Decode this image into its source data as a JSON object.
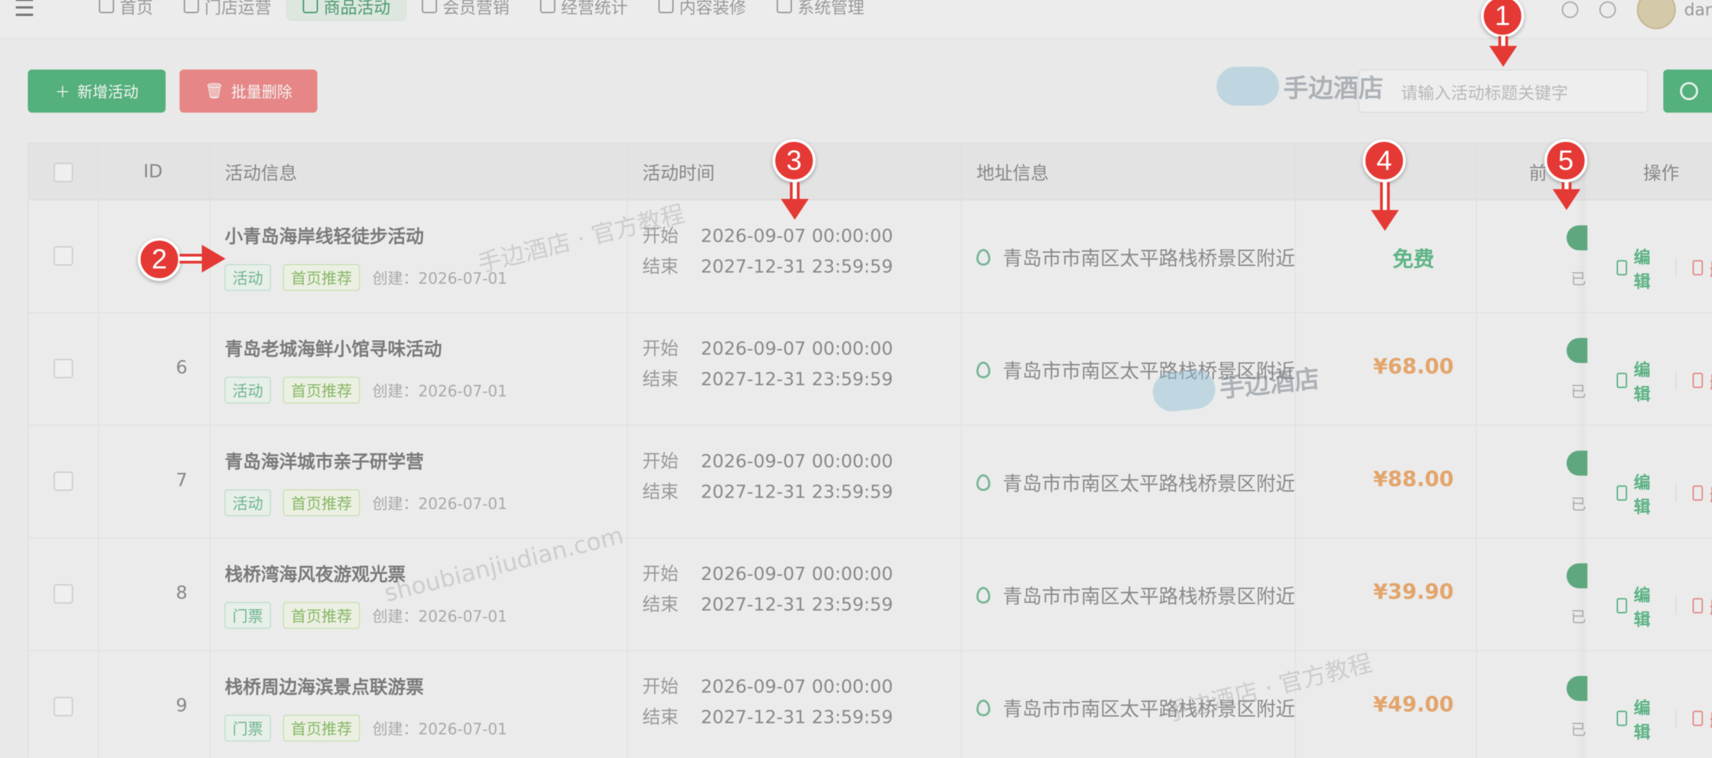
{
  "nav": {
    "items": [
      {
        "label": "首页"
      },
      {
        "label": "门店运营"
      },
      {
        "label": "商品活动"
      },
      {
        "label": "会员营销"
      },
      {
        "label": "经营统计"
      },
      {
        "label": "内容装修"
      },
      {
        "label": "系统管理"
      }
    ],
    "user_name": "dand"
  },
  "toolbar": {
    "add_label": "新增活动",
    "delete_label": "批量删除",
    "search_placeholder": "请输入活动标题关键字"
  },
  "brand": "手边酒店",
  "table": {
    "columns": {
      "id": "ID",
      "info": "活动信息",
      "time": "活动时间",
      "address": "地址信息",
      "front": "前",
      "actions": "操作"
    },
    "start_label": "开始",
    "end_label": "结束",
    "created_prefix": "创建：",
    "edit_label": "编辑",
    "delete_label": "删",
    "status_label": "已",
    "rows": [
      {
        "id": "",
        "title": "小青岛海岸线轻徒步活动",
        "tag": "活动",
        "tag2": "首页推荐",
        "created": "2026-07-01",
        "start": "2026-09-07 00:00:00",
        "end": "2027-12-31 23:59:59",
        "address": "青岛市市南区太平路栈桥景区附近",
        "price": "免费"
      },
      {
        "id": "6",
        "title": "青岛老城海鲜小馆寻味活动",
        "tag": "活动",
        "tag2": "首页推荐",
        "created": "2026-07-01",
        "start": "2026-09-07 00:00:00",
        "end": "2027-12-31 23:59:59",
        "address": "青岛市市南区太平路栈桥景区附近",
        "price": "¥68.00"
      },
      {
        "id": "7",
        "title": "青岛海洋城市亲子研学营",
        "tag": "活动",
        "tag2": "首页推荐",
        "created": "2026-07-01",
        "start": "2026-09-07 00:00:00",
        "end": "2027-12-31 23:59:59",
        "address": "青岛市市南区太平路栈桥景区附近",
        "price": "¥88.00"
      },
      {
        "id": "8",
        "title": "栈桥湾海风夜游观光票",
        "tag": "门票",
        "tag2": "首页推荐",
        "created": "2026-07-01",
        "start": "2026-09-07 00:00:00",
        "end": "2027-12-31 23:59:59",
        "address": "青岛市市南区太平路栈桥景区附近",
        "price": "¥39.90"
      },
      {
        "id": "9",
        "title": "栈桥周边海滨景点联游票",
        "tag": "门票",
        "tag2": "首页推荐",
        "created": "2026-07-01",
        "start": "2026-09-07 00:00:00",
        "end": "2027-12-31 23:59:59",
        "address": "青岛市市南区太平路栈桥景区附近",
        "price": "¥49.00"
      }
    ]
  },
  "watermarks": [
    "手边酒店 · 官方教程",
    "shoubianjiudian.com",
    "手边酒店 · 官方教程"
  ],
  "markers": [
    "1",
    "2",
    "3",
    "4",
    "5"
  ],
  "colors": {
    "accent": "#54b07c",
    "danger": "#e78686",
    "price": "#e3a56b",
    "marker": "#e53935"
  }
}
